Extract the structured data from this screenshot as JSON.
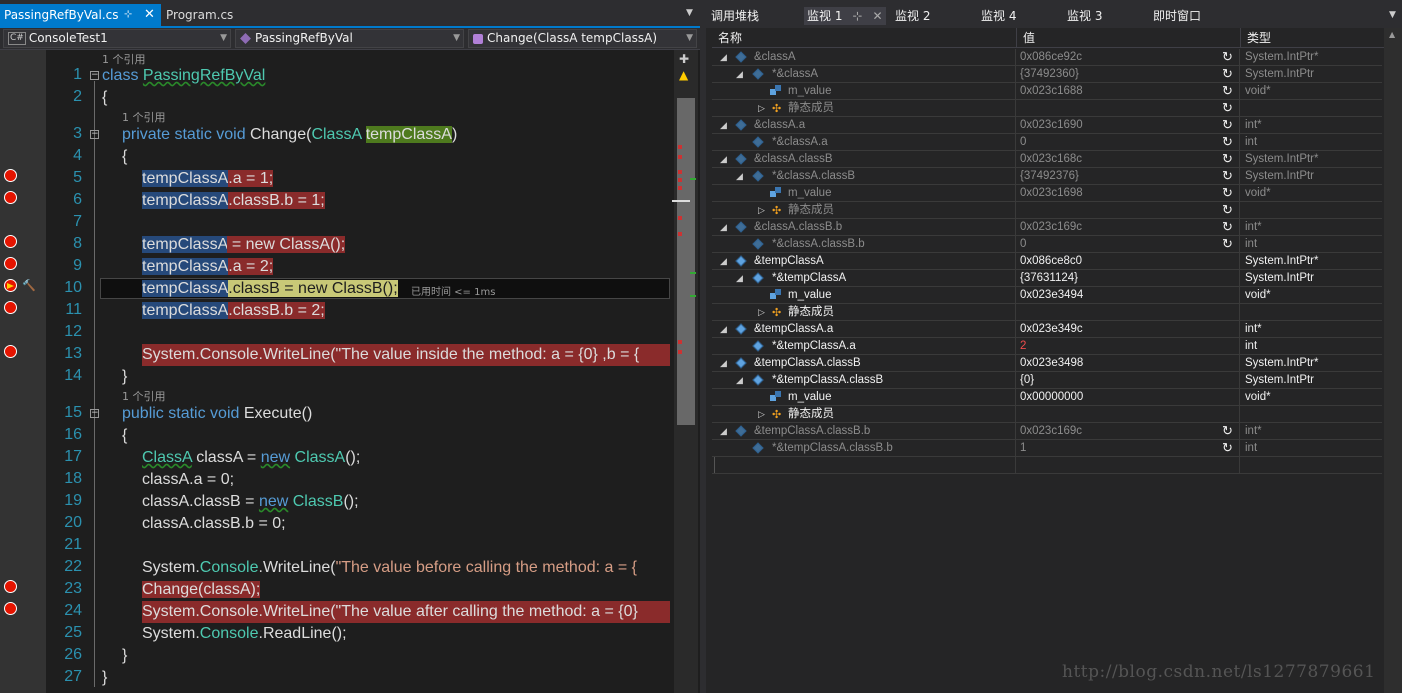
{
  "editor": {
    "tabs": {
      "active": "PassingRefByVal.cs",
      "pin": "⊹",
      "close": "✕",
      "other": "Program.cs",
      "dropdown": "▼"
    },
    "nav": {
      "project": "ConsoleTest1",
      "class": "PassingRefByVal",
      "member": "Change(ClassA tempClassA)",
      "arrow": "▼"
    },
    "project_icon": "C#",
    "ref_text": "1 个引用",
    "elapsed": "已用时间 <= 1ms",
    "lines": {
      "l1": {
        "num": "1",
        "kw": "class",
        "name": "PassingRefByVal"
      },
      "l2": {
        "num": "2",
        "text": "{"
      },
      "l3": {
        "num": "3",
        "pre": "private static void",
        "fn": " Change(",
        "ty": "ClassA",
        "sp": " ",
        "param": "tempClassA",
        "post": ")"
      },
      "l4": {
        "num": "4",
        "text": "{"
      },
      "l5": {
        "num": "5",
        "sel": "tempClassA",
        "rest": ".a = 1;"
      },
      "l6": {
        "num": "6",
        "sel": "tempClassA",
        "rest": ".classB.b = 1;"
      },
      "l7": {
        "num": "7"
      },
      "l8": {
        "num": "8",
        "sel": "tempClassA",
        "rest": " = new ClassA();"
      },
      "l9": {
        "num": "9",
        "sel": "tempClassA",
        "rest": ".a = 2;"
      },
      "l10": {
        "num": "10",
        "sel": "tempClassA",
        "rest": ".classB = new ClassB();"
      },
      "l11": {
        "num": "11",
        "sel": "tempClassA",
        "rest": ".classB.b = 2;"
      },
      "l12": {
        "num": "12"
      },
      "l13": {
        "num": "13",
        "text": "System.Console.WriteLine(\"The value inside the method: a = {0} ,b = {"
      },
      "l14": {
        "num": "14",
        "text": "}"
      },
      "l15": {
        "num": "15",
        "kw": "public static void",
        "rest": " Execute()"
      },
      "l16": {
        "num": "16",
        "text": "{"
      },
      "l17": {
        "num": "17",
        "ty": "ClassA",
        "mid": " classA = ",
        "kw": "new",
        "sp": " ",
        "ty2": "ClassA",
        "end": "();"
      },
      "l18": {
        "num": "18",
        "text": "classA.a = 0;"
      },
      "l19": {
        "num": "19",
        "pre": "classA.classB = ",
        "kw": "new",
        "sp": " ",
        "ty": "ClassB",
        "end": "();"
      },
      "l20": {
        "num": "20",
        "text": "classA.classB.b = 0;"
      },
      "l21": {
        "num": "21"
      },
      "l22": {
        "num": "22",
        "pre": "System.",
        "ty": "Console",
        "mid": ".WriteLine(",
        "str": "\"The value before calling the method: a = {"
      },
      "l23": {
        "num": "23",
        "text": "Change(classA);"
      },
      "l24": {
        "num": "24",
        "text": "System.Console.WriteLine(\"The value after calling the method: a = {0}"
      },
      "l25": {
        "num": "25",
        "pre": "System.",
        "ty": "Console",
        "end": ".ReadLine();"
      },
      "l26": {
        "num": "26",
        "text": "}"
      },
      "l27": {
        "num": "27",
        "text": "}"
      }
    }
  },
  "watch": {
    "tabs": {
      "callstack": "调用堆栈",
      "w1": "监视 1",
      "pin": "⊹",
      "close": "✕",
      "w2": "监视 2",
      "w4": "监视 4",
      "w3": "监视 3",
      "immediate": "即时窗口",
      "dropdown": "▼"
    },
    "headers": {
      "name": "名称",
      "value": "值",
      "type": "类型"
    },
    "refresh_icon": "↻",
    "rows": [
      {
        "name": "&classA",
        "value": "0x086ce92c",
        "type": "System.IntPtr*"
      },
      {
        "name": "*&classA",
        "value": "{37492360}",
        "type": "System.IntPtr"
      },
      {
        "name": "m_value",
        "value": "0x023c1688",
        "type": "void*"
      },
      {
        "name": "静态成员",
        "value": "",
        "type": ""
      },
      {
        "name": "&classA.a",
        "value": "0x023c1690",
        "type": "int*"
      },
      {
        "name": "*&classA.a",
        "value": "0",
        "type": "int"
      },
      {
        "name": "&classA.classB",
        "value": "0x023c168c",
        "type": "System.IntPtr*"
      },
      {
        "name": "*&classA.classB",
        "value": "{37492376}",
        "type": "System.IntPtr"
      },
      {
        "name": "m_value",
        "value": "0x023c1698",
        "type": "void*"
      },
      {
        "name": "静态成员",
        "value": "",
        "type": ""
      },
      {
        "name": "&classA.classB.b",
        "value": "0x023c169c",
        "type": "int*"
      },
      {
        "name": "*&classA.classB.b",
        "value": "0",
        "type": "int"
      },
      {
        "name": "&tempClassA",
        "value": "0x086ce8c0",
        "type": "System.IntPtr*"
      },
      {
        "name": "*&tempClassA",
        "value": "{37631124}",
        "type": "System.IntPtr"
      },
      {
        "name": "m_value",
        "value": "0x023e3494",
        "type": "void*"
      },
      {
        "name": "静态成员",
        "value": "",
        "type": ""
      },
      {
        "name": "&tempClassA.a",
        "value": "0x023e349c",
        "type": "int*"
      },
      {
        "name": "*&tempClassA.a",
        "value": "2",
        "type": "int"
      },
      {
        "name": "&tempClassA.classB",
        "value": "0x023e3498",
        "type": "System.IntPtr*"
      },
      {
        "name": "*&tempClassA.classB",
        "value": "{0}",
        "type": "System.IntPtr"
      },
      {
        "name": "m_value",
        "value": "0x00000000",
        "type": "void*"
      },
      {
        "name": "静态成员",
        "value": "",
        "type": ""
      },
      {
        "name": "&tempClassA.classB.b",
        "value": "0x023c169c",
        "type": "int*"
      },
      {
        "name": "*&tempClassA.classB.b",
        "value": "1",
        "type": "int"
      }
    ]
  },
  "watermark": "http://blog.csdn.net/ls1277879661",
  "colors": {
    "accent": "#007acc",
    "breakpoint": "#e51400",
    "breakpoint_line": "#8a2b2b",
    "keyword": "#569cd6",
    "type": "#4ec9b0"
  }
}
